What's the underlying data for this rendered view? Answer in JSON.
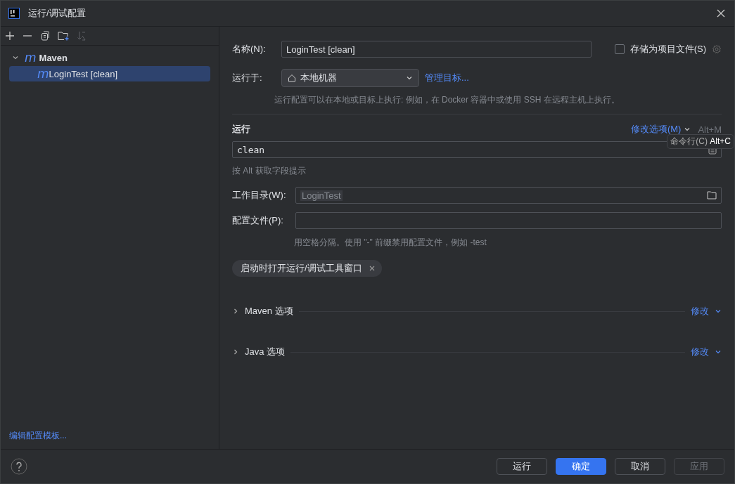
{
  "window": {
    "title": "运行/调试配置"
  },
  "toolbar": {
    "buttons": [
      {
        "kind": "add"
      },
      {
        "kind": "remove"
      },
      {
        "kind": "copy"
      },
      {
        "kind": "folder"
      },
      {
        "kind": "sort",
        "disabled": true
      }
    ]
  },
  "tree": [
    {
      "icon": "m",
      "label": "Maven",
      "expanded": true,
      "selected": false,
      "children": [
        {
          "icon": "m",
          "label": "LoginTest [clean]",
          "selected": true
        }
      ]
    }
  ],
  "edit_templates_link": "编辑配置模板...",
  "form": {
    "name_label": "名称(N):",
    "name_value": "LoginTest [clean]",
    "store_checkbox": {
      "label": "存储为项目文件(S)",
      "checked": false
    },
    "run_on_label": "运行于:",
    "run_on_value": "本地机器",
    "manage_targets_link": "管理目标...",
    "run_on_hint": "运行配置可以在本地或目标上执行: 例如，在 Docker 容器中或使用 SSH 在远程主机上执行。",
    "run_section_title": "运行",
    "modify_options_link": "修改选项(M)",
    "modify_options_shortcut": "Alt+M",
    "tooltip": {
      "label": "命令行(C)",
      "shortcut": "Alt+C"
    },
    "command_value": "clean",
    "alt_hint": "按 Alt 获取字段提示",
    "workdir_label": "工作目录(W):",
    "workdir_value": "LoginTest",
    "profiles_label": "配置文件(P):",
    "profiles_hint": "用空格分隔。使用 \"-\" 前缀禁用配置文件，例如 -test",
    "chip": "启动时打开运行/调试工具窗口",
    "sections": [
      {
        "title": "Maven 选项",
        "expanded": false,
        "link": "修改"
      },
      {
        "title": "Java 选项",
        "expanded": false,
        "link": "修改"
      }
    ]
  },
  "buttons": [
    {
      "label": "运行",
      "kind": "normal",
      "disabled": false
    },
    {
      "label": "确定",
      "kind": "primary",
      "disabled": false
    },
    {
      "label": "取消",
      "kind": "normal",
      "disabled": false
    },
    {
      "label": "应用",
      "kind": "normal",
      "disabled": true
    }
  ]
}
